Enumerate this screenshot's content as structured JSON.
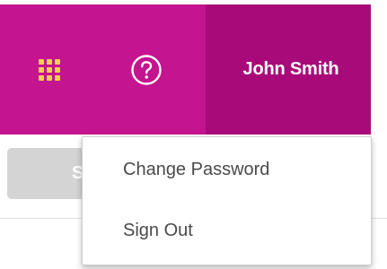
{
  "header": {
    "apps_icon": "apps-grid-icon",
    "help_icon": "help-circle-icon",
    "user_name": "John Smith",
    "bar_color": "#c4148f",
    "user_bg_color": "#a80b79",
    "apps_icon_color": "#f4d04a"
  },
  "page": {
    "partial_button_label": "S"
  },
  "user_menu": {
    "items": [
      {
        "label": "Change Password"
      },
      {
        "label": "Sign Out"
      }
    ]
  }
}
